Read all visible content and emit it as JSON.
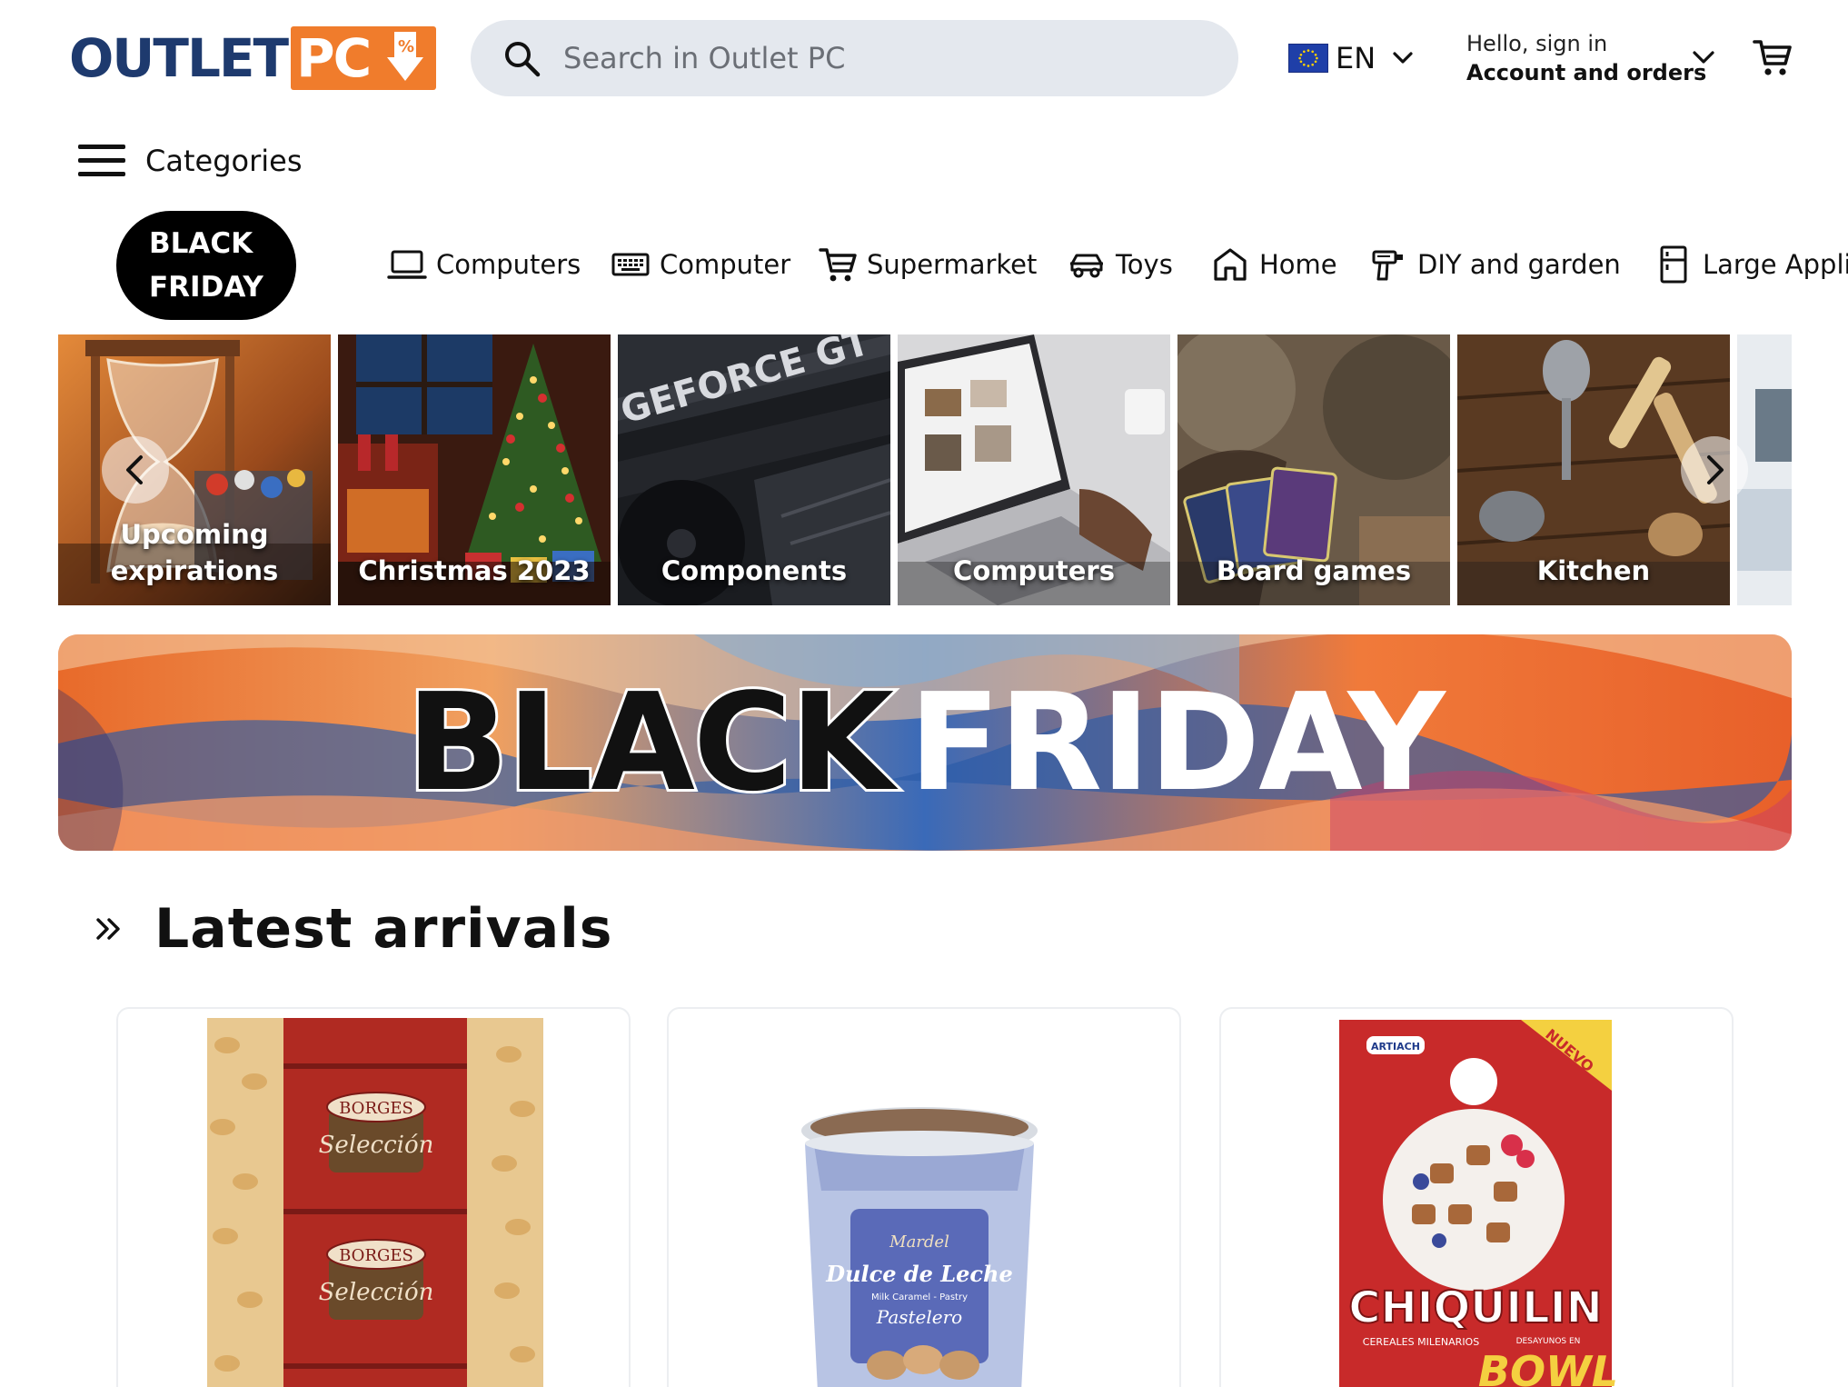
{
  "header": {
    "logo": {
      "part1": "OUTLET",
      "part2": "PC"
    },
    "search": {
      "placeholder": "Search in Outlet PC",
      "value": ""
    },
    "language": {
      "label": "EN",
      "flag": "eu-flag"
    },
    "account": {
      "greeting": "Hello, sign in",
      "link": "Account and orders"
    },
    "cart_icon": "cart-icon"
  },
  "categories": {
    "label": "Categories"
  },
  "nav": {
    "black_friday": {
      "line1": "BLACK",
      "line2": "FRIDAY"
    },
    "items": [
      {
        "label": "Computers",
        "icon": "laptop-icon"
      },
      {
        "label": "Computer",
        "icon": "keyboard-icon"
      },
      {
        "label": "Supermarket",
        "icon": "cart-icon"
      },
      {
        "label": "Toys",
        "icon": "car-icon"
      },
      {
        "label": "Home",
        "icon": "home-icon"
      },
      {
        "label": "DIY and garden",
        "icon": "drill-icon"
      },
      {
        "label": "Large Appli",
        "icon": "fridge-icon"
      }
    ]
  },
  "tiles": [
    {
      "label1": "Upcoming",
      "label2": "expirations"
    },
    {
      "label1": "Christmas 2023",
      "label2": ""
    },
    {
      "label1": "Components",
      "label2": ""
    },
    {
      "label1": "Computers",
      "label2": ""
    },
    {
      "label1": "Board games",
      "label2": ""
    },
    {
      "label1": "Kitchen",
      "label2": ""
    }
  ],
  "tile_texts": {
    "geforce": "GEFORCE GT"
  },
  "banner": {
    "word1": "BLACK",
    "word2": "FRIDAY"
  },
  "latest": {
    "title": "Latest arrivals"
  },
  "products": [
    {
      "brand": "BORGES",
      "line": "Selección"
    },
    {
      "brand": "Mardel",
      "line": "Dulce de Leche",
      "sub": "Milk Caramel - Pastry",
      "line2": "Pastelero"
    },
    {
      "brand": "ARTIACH",
      "line": "CHIQUILIN",
      "sub": "CEREALES MILENARIOS",
      "line2": "BOWL",
      "badge": "NUEVO",
      "sub2": "DESAYUNOS EN"
    }
  ],
  "colors": {
    "brand_blue": "#1e3a6e",
    "brand_orange": "#f07c2c",
    "search_bg": "#e4e8ee"
  }
}
